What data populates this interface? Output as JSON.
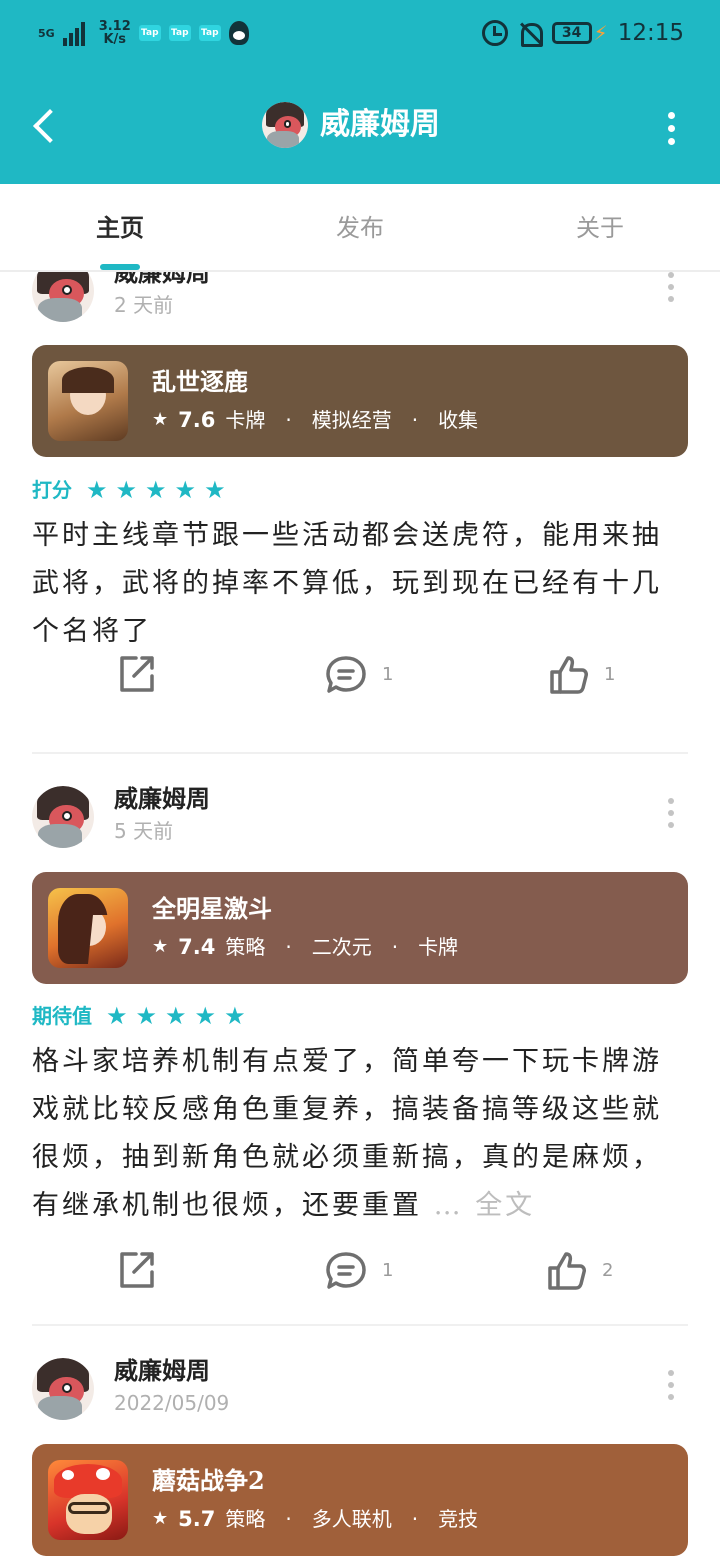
{
  "status_bar": {
    "network": "5G",
    "speed_value": "3.12",
    "speed_unit": "K/s",
    "tap_badges": [
      "Tap",
      "Tap",
      "Tap"
    ],
    "battery": "34",
    "time": "12:15"
  },
  "header": {
    "title": "威廉姆周"
  },
  "tabs": [
    {
      "label": "主页",
      "active": true
    },
    {
      "label": "发布",
      "active": false
    },
    {
      "label": "关于",
      "active": false
    }
  ],
  "posts": [
    {
      "author": "威廉姆周",
      "time": "2 天前",
      "game": {
        "name": "乱世逐鹿",
        "score": "7.6",
        "tags": [
          "卡牌",
          "模拟经营",
          "收集"
        ],
        "card_color": "#6e563f"
      },
      "rating_label": "打分",
      "stars": 5,
      "text": "平时主线章节跟一些活动都会送虎符，能用来抽武将，武将的掉率不算低，玩到现在已经有十几个名将了",
      "share_count": "",
      "comment_count": "1",
      "like_count": "1"
    },
    {
      "author": "威廉姆周",
      "time": "5 天前",
      "game": {
        "name": "全明星激斗",
        "score": "7.4",
        "tags": [
          "策略",
          "二次元",
          "卡牌"
        ],
        "card_color": "#845c4e"
      },
      "rating_label": "期待值",
      "stars": 5,
      "text": "格斗家培养机制有点爱了，简单夸一下玩卡牌游戏就比较反感角色重复养，搞装备搞等级这些就很烦，抽到新角色就必须重新搞，真的是麻烦，有继承机制也很烦，还要重置",
      "ellipsis": "…",
      "full_text_label": "全文",
      "comment_count": "1",
      "like_count": "2"
    },
    {
      "author": "威廉姆周",
      "time": "2022/05/09",
      "game": {
        "name": "蘑菇战争2",
        "score": "5.7",
        "tags": [
          "策略",
          "多人联机",
          "竞技"
        ],
        "card_color": "#a0603a"
      }
    }
  ],
  "icons": {
    "back": "back-arrow-icon",
    "menu": "more-vertical-icon",
    "share": "share-icon",
    "comment": "comment-icon",
    "like": "thumbs-up-icon",
    "star": "star-icon"
  },
  "colors": {
    "accent": "#1fb8c4",
    "muted": "#b0b0b0"
  }
}
